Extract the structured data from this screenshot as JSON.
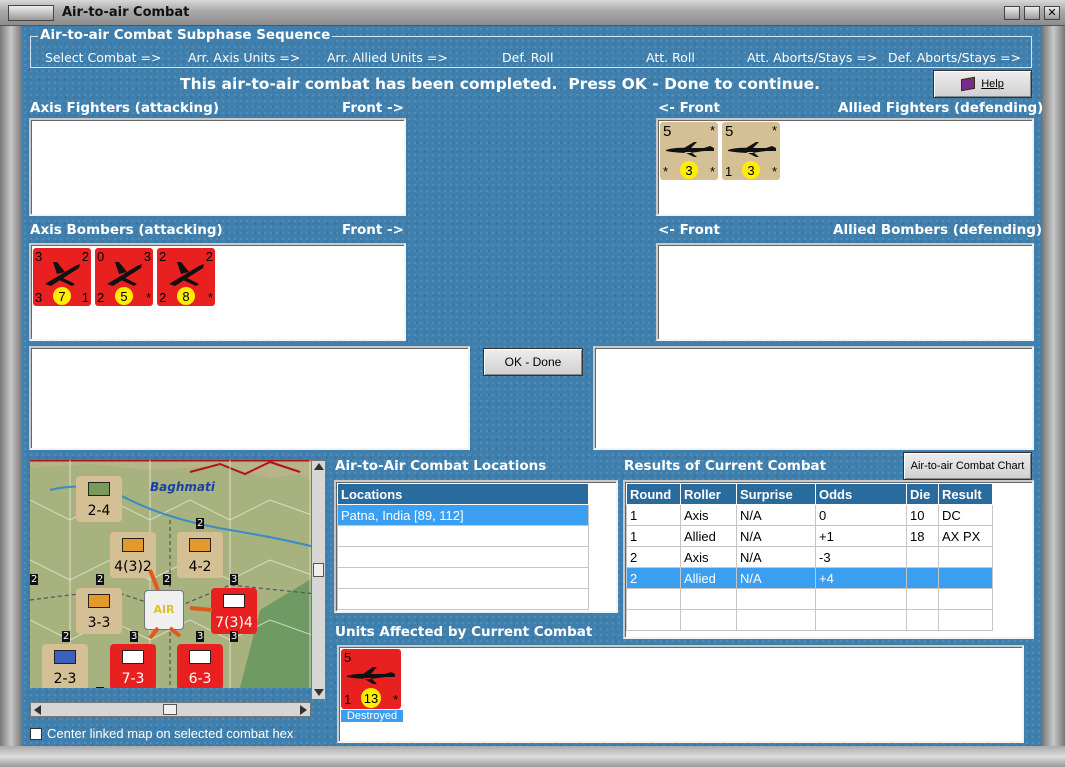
{
  "window": {
    "title": "Air-to-air Combat"
  },
  "sequence": {
    "title": "Air-to-air Combat Subphase Sequence",
    "steps": [
      "Select Combat =>",
      "Arr. Axis Units =>",
      "Arr. Allied Units =>",
      "Def. Roll",
      "Att. Roll",
      "Att. Aborts/Stays =>",
      "Def. Aborts/Stays =>"
    ]
  },
  "status_message": "This air-to-air combat has been completed.  Press OK - Done to continue.",
  "help_button": "Help",
  "sections": {
    "axis_fighters": "Axis Fighters (attacking)",
    "axis_fighters_front": "Front ->",
    "allied_fighters": "Allied Fighters (defending)",
    "allied_fighters_front": "<- Front",
    "axis_bombers": "Axis Bombers (attacking)",
    "axis_bombers_front": "Front ->",
    "allied_bombers": "Allied Bombers (defending)",
    "allied_bombers_front": "<- Front"
  },
  "allied_fighter_counters": [
    {
      "tl": "5",
      "tr": "*",
      "bl": "*",
      "circle": "3",
      "br": "*"
    },
    {
      "tl": "5",
      "tr": "*",
      "bl": "1",
      "circle": "3",
      "br": "*"
    }
  ],
  "axis_bomber_counters": [
    {
      "tl": "3",
      "tr": "2",
      "bl": "3",
      "circle": "7",
      "br": "1"
    },
    {
      "tl": "0",
      "tr": "3",
      "bl": "2",
      "circle": "5",
      "br": "*"
    },
    {
      "tl": "2",
      "tr": "2",
      "bl": "2",
      "circle": "8",
      "br": "*"
    }
  ],
  "ok_button": "OK - Done",
  "locations": {
    "title": "Air-to-Air Combat Locations",
    "header": "Locations",
    "rows": [
      "Patna, India [89, 112]",
      "",
      "",
      "",
      ""
    ]
  },
  "results": {
    "title": "Results of Current Combat",
    "chart_button": "Air-to-air Combat Chart",
    "headers": [
      "Round",
      "Roller",
      "Surprise",
      "Odds",
      "Die",
      "Result"
    ],
    "rows": [
      [
        "1",
        "Axis",
        "N/A",
        "0",
        "10",
        "DC"
      ],
      [
        "1",
        "Allied",
        "N/A",
        "+1",
        "18",
        "AX PX"
      ],
      [
        "2",
        "Axis",
        "N/A",
        "-3",
        "",
        ""
      ],
      [
        "2",
        "Allied",
        "N/A",
        "+4",
        "",
        ""
      ],
      [
        "",
        "",
        "",
        "",
        "",
        ""
      ],
      [
        "",
        "",
        "",
        "",
        "",
        ""
      ]
    ],
    "selected_row": 3
  },
  "affected": {
    "title": "Units Affected by Current Combat",
    "unit": {
      "tl": "5",
      "bl": "1",
      "circle": "13",
      "br": "*",
      "status": "Destroyed"
    }
  },
  "map": {
    "place_label": "Baghmati",
    "units": [
      {
        "label": "2-4",
        "kind": "tan"
      },
      {
        "label": "4(3)2",
        "kind": "tan"
      },
      {
        "label": "4-2",
        "kind": "tan"
      },
      {
        "label": "3-3",
        "kind": "tan"
      },
      {
        "label": "AIR",
        "kind": "air"
      },
      {
        "label": "7(3)4",
        "kind": "red"
      },
      {
        "label": "2-3",
        "kind": "tan"
      },
      {
        "label": "7-3",
        "kind": "red"
      },
      {
        "label": "6-3",
        "kind": "red"
      }
    ],
    "stack_numbers": [
      "2",
      "2",
      "2",
      "3",
      "2",
      "3",
      "3",
      "2",
      "3"
    ],
    "edge_label": "3"
  },
  "center_checkbox": {
    "label": "Center linked map on selected combat hex",
    "checked": false
  },
  "colors": {
    "panel_blue": "#3f7fad",
    "header_blue": "#2a6b9e",
    "selection": "#3a9ff0",
    "counter_red": "#e82020",
    "counter_tan": "#d4c094",
    "circle_yellow": "#ffee00"
  }
}
